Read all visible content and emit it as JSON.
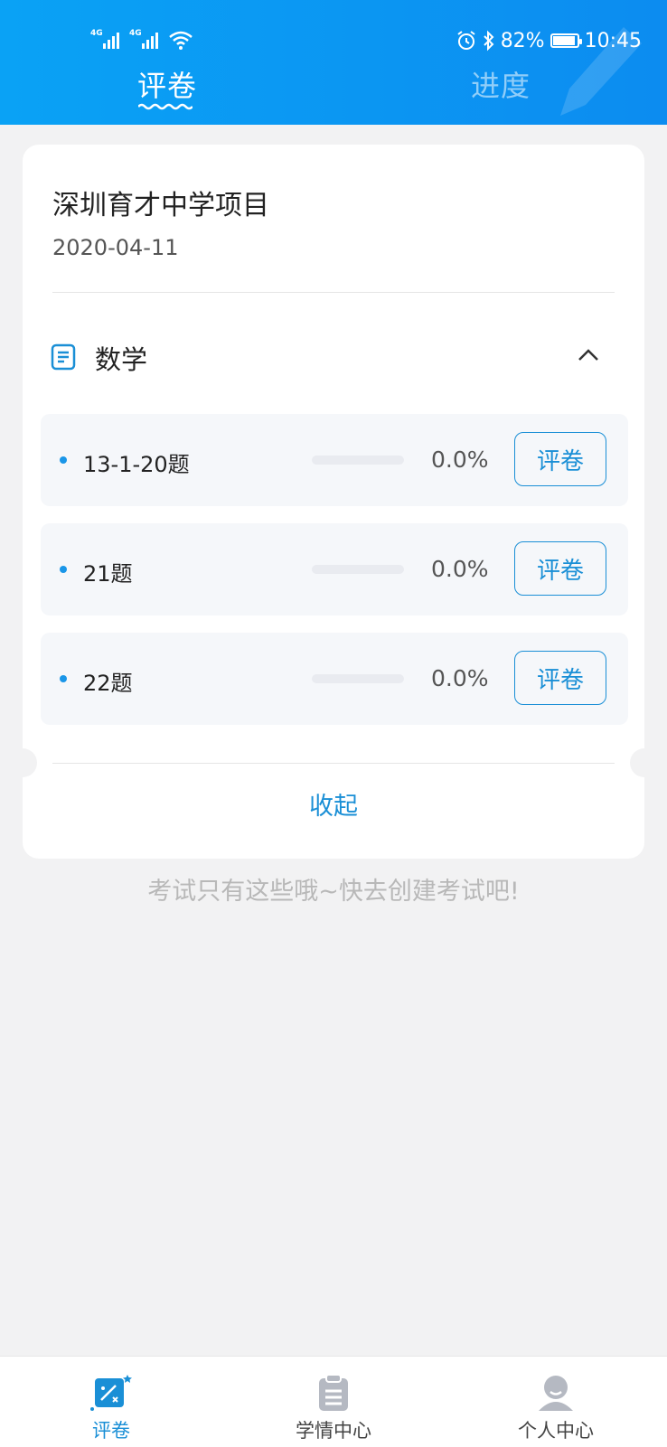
{
  "status_bar": {
    "network_1": "4G",
    "network_2": "4G",
    "battery": "82%",
    "time": "10:45"
  },
  "top_tabs": [
    {
      "label": "评卷",
      "active": true
    },
    {
      "label": "进度",
      "active": false
    }
  ],
  "project": {
    "title": "深圳育才中学项目",
    "date": "2020-04-11"
  },
  "subject": {
    "name": "数学",
    "questions": [
      {
        "name": "13-1-20题",
        "progress_percent": 0,
        "progress_text": "0.0%",
        "action": "评卷"
      },
      {
        "name": "21题",
        "progress_percent": 0,
        "progress_text": "0.0%",
        "action": "评卷"
      },
      {
        "name": "22题",
        "progress_percent": 0,
        "progress_text": "0.0%",
        "action": "评卷"
      }
    ],
    "collapse_label": "收起"
  },
  "footnote": "考试只有这些哦~快去创建考试吧!",
  "bottom_nav": [
    {
      "label": "评卷",
      "icon": "grading-icon",
      "active": true
    },
    {
      "label": "学情中心",
      "icon": "clipboard-icon",
      "active": false
    },
    {
      "label": "个人中心",
      "icon": "person-icon",
      "active": false
    }
  ],
  "colors": {
    "brand": "#0c8cf0",
    "accent": "#1a8fd6",
    "background": "#f2f2f3"
  }
}
